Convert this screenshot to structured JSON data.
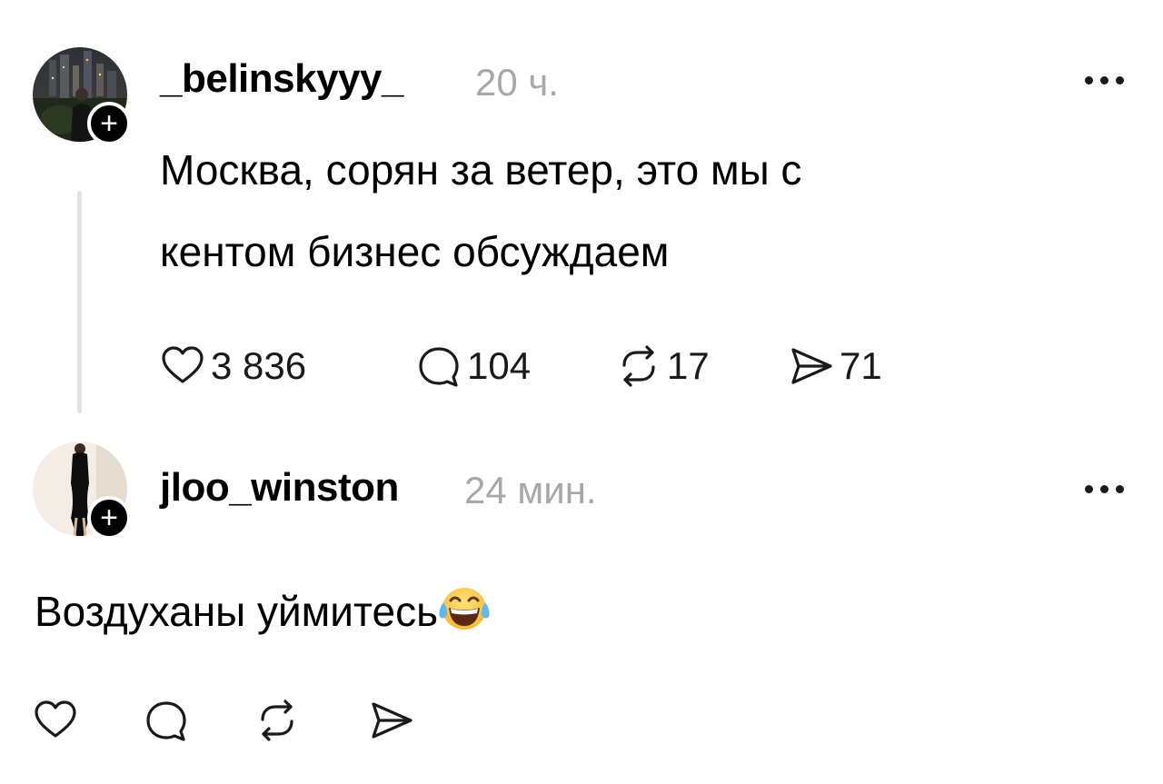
{
  "posts": [
    {
      "username": "_belinskyyy_",
      "time": "20 ч.",
      "text_lines": [
        "Москва, сорян за ветер, это мы с",
        "кентом бизнес обсуждаем"
      ],
      "likes": "3 836",
      "comments": "104",
      "reposts": "17",
      "shares": "71"
    },
    {
      "username": "jloo_winston",
      "time": "24 мин.",
      "text": "Воздуханы уймитесь",
      "emoji": "face-with-tears-of-joy"
    }
  ],
  "icons": [
    "heart-icon",
    "comment-icon",
    "repost-icon",
    "share-icon",
    "more-icon",
    "follow-plus-icon"
  ],
  "colors": {
    "text": "#000000",
    "muted": "#a8a8a8",
    "thread_line": "#e2e2e2",
    "badge": "#000000"
  }
}
